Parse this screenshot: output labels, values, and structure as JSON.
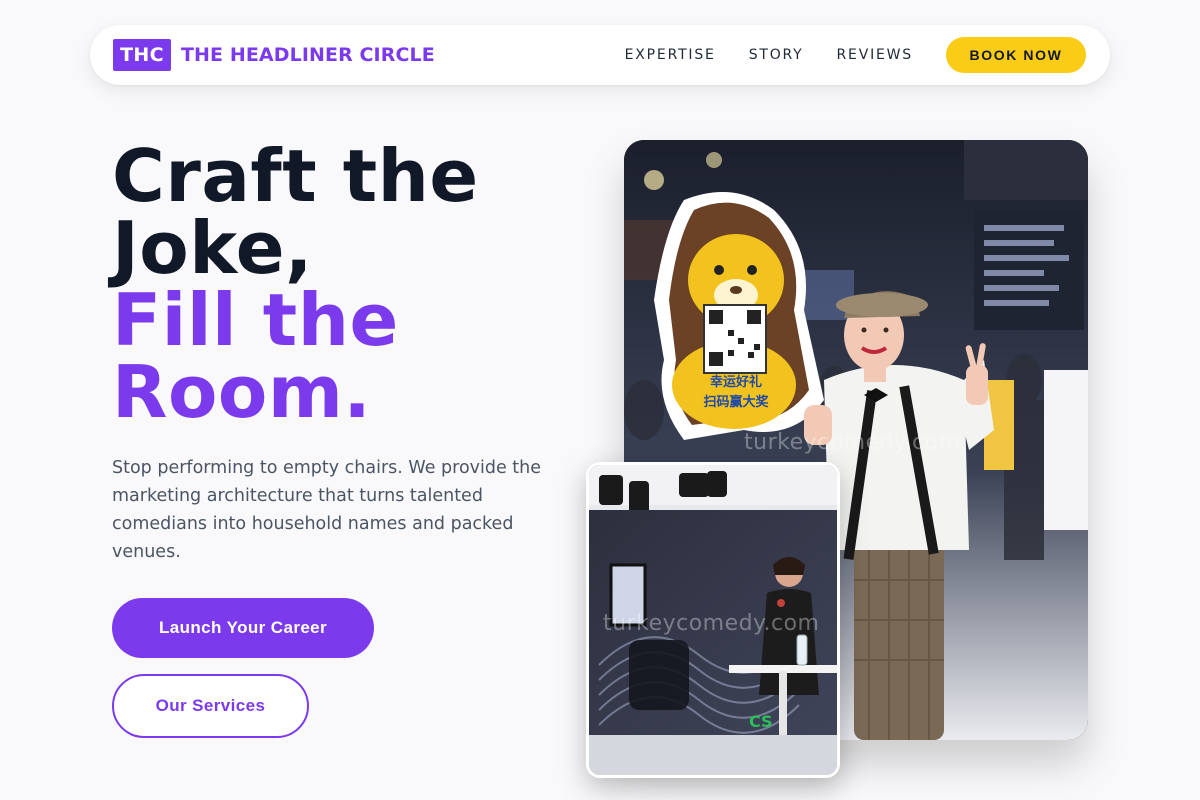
{
  "brand": {
    "logo_text": "THC",
    "name": "THE HEADLINER CIRCLE"
  },
  "nav": {
    "links": [
      "EXPERTISE",
      "STORY",
      "REVIEWS"
    ],
    "cta": "BOOK NOW"
  },
  "hero": {
    "headline_dark_1": "Craft the",
    "headline_dark_2": "Joke,",
    "headline_purple_1": "Fill the",
    "headline_purple_2": "Room.",
    "subtext": "Stop performing to empty chairs. We provide the marketing architecture that turns talented comedians into household names and packed venues.",
    "primary_button": "Launch Your Career",
    "secondary_button": "Our Services"
  },
  "images": {
    "main_watermark": "turkeycomedy.com",
    "small_watermark": "turkeycomedy.com",
    "sign_text_1": "幸运好礼",
    "sign_text_2": "扫码赢大奖"
  },
  "colors": {
    "accent": "#7c3aed",
    "cta": "#facc15",
    "text_dark": "#111827",
    "text_muted": "#4b5563",
    "background": "#f9f9fb"
  }
}
